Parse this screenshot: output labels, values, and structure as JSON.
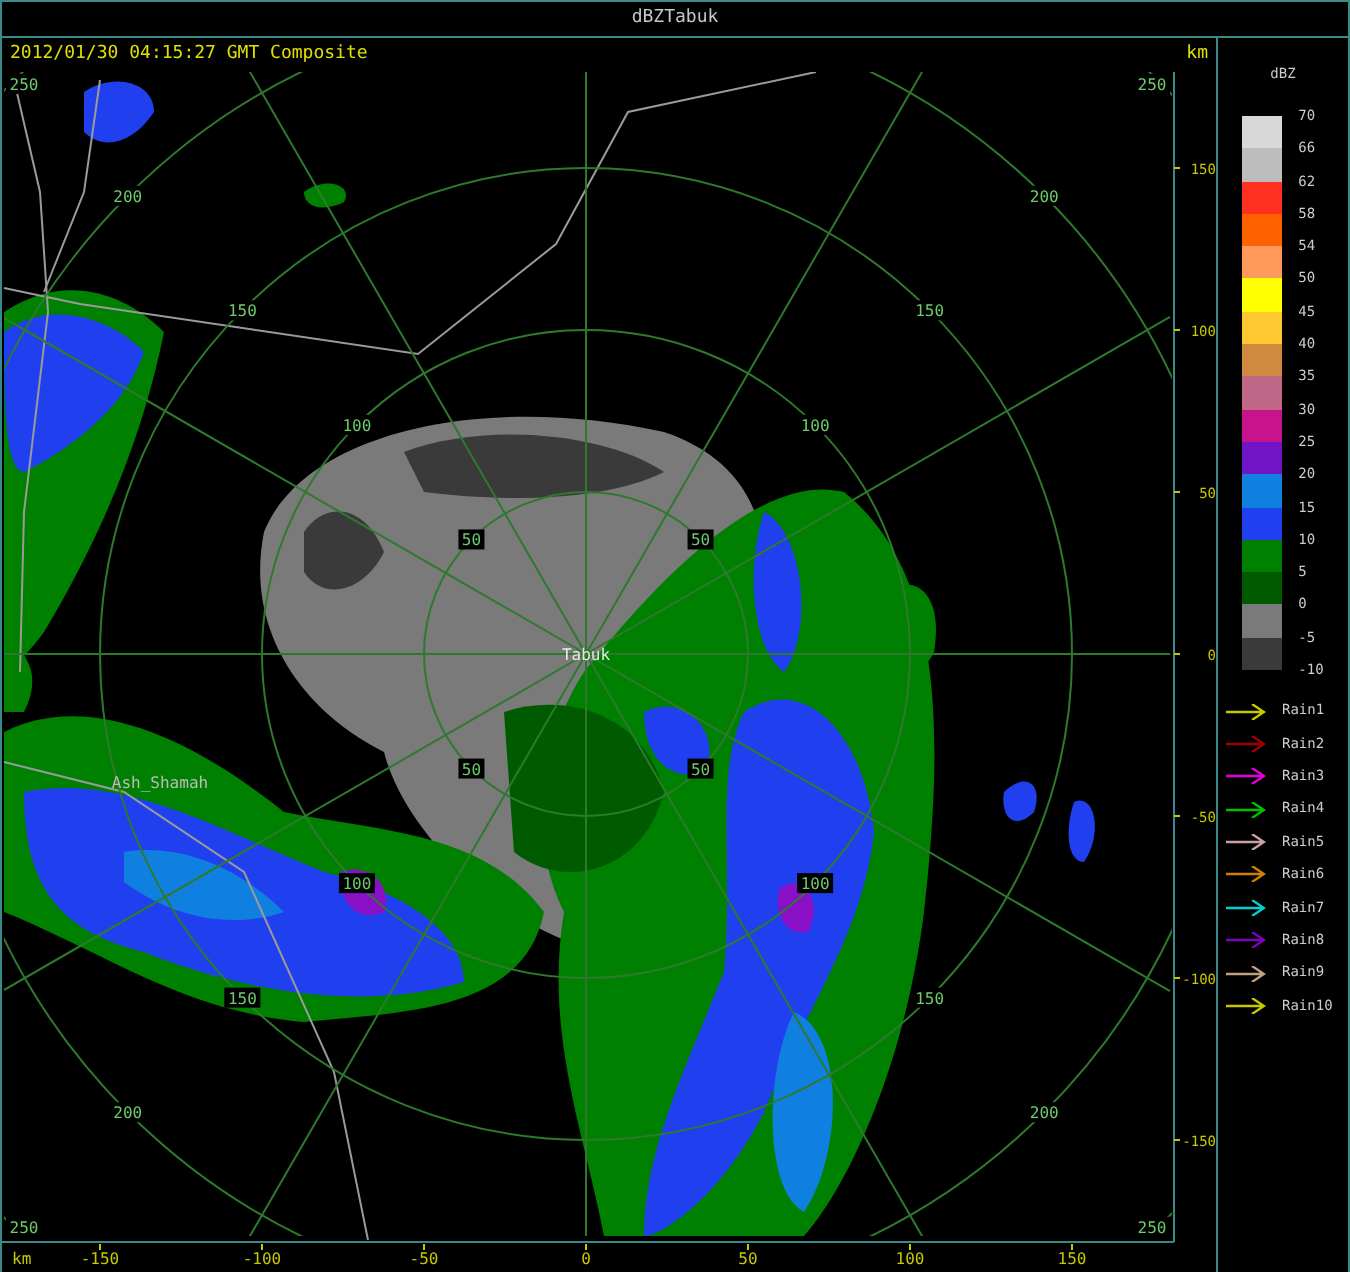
{
  "window": {
    "title": "dBZTabuk"
  },
  "map": {
    "header": "2012/01/30 04:15:27 GMT Composite",
    "unit_top": "km",
    "unit_bottom": "km",
    "range_rings": [
      {
        "labels": [
          "50",
          "50",
          "50",
          "50"
        ]
      },
      {
        "labels": [
          "100",
          "100",
          "100",
          "100"
        ]
      },
      {
        "labels": [
          "150",
          "150",
          "150",
          "150"
        ]
      },
      {
        "labels": [
          "200",
          "200",
          "200",
          "200"
        ]
      },
      {
        "labels": [
          "250",
          "250",
          "250",
          "250"
        ]
      }
    ],
    "places": [
      {
        "name": "Tabuk"
      },
      {
        "name": "Ash_Shamah"
      }
    ],
    "y_axis": [
      "150",
      "100",
      "50",
      "0",
      "-50",
      "-100",
      "-150"
    ],
    "x_axis": [
      "-150",
      "-100",
      "-50",
      "0",
      "50",
      "100",
      "150"
    ]
  },
  "legend": {
    "title": "dBZ",
    "swatches": [
      {
        "color": "#d8d8d8"
      },
      {
        "color": "#bdbdbd"
      },
      {
        "color": "#ff3020"
      },
      {
        "color": "#ff6000"
      },
      {
        "color": "#ff9a5a"
      },
      {
        "color": "#ffff00"
      },
      {
        "color": "#ffc830"
      },
      {
        "color": "#d08a40"
      },
      {
        "color": "#c06888"
      },
      {
        "color": "#c8148c"
      },
      {
        "color": "#7014c8"
      },
      {
        "color": "#1080e0"
      },
      {
        "color": "#2040f0"
      },
      {
        "color": "#008000"
      },
      {
        "color": "#005a00"
      },
      {
        "color": "#7a7a7a"
      },
      {
        "color": "#3a3a3a"
      }
    ],
    "labels": [
      "70",
      "66",
      "62",
      "58",
      "54",
      "50",
      "45",
      "40",
      "35",
      "30",
      "25",
      "20",
      "15",
      "10",
      "5",
      "0",
      "-5",
      "-10"
    ],
    "rain_series": [
      {
        "name": "Rain1",
        "color": "#c8c800"
      },
      {
        "name": "Rain2",
        "color": "#a00000"
      },
      {
        "name": "Rain3",
        "color": "#e000e0"
      },
      {
        "name": "Rain4",
        "color": "#00c000"
      },
      {
        "name": "Rain5",
        "color": "#d0a0a0"
      },
      {
        "name": "Rain6",
        "color": "#d08000"
      },
      {
        "name": "Rain7",
        "color": "#00d0d0"
      },
      {
        "name": "Rain8",
        "color": "#8000c0"
      },
      {
        "name": "Rain9",
        "color": "#c0a080"
      },
      {
        "name": "Rain10",
        "color": "#c8c800"
      }
    ]
  }
}
